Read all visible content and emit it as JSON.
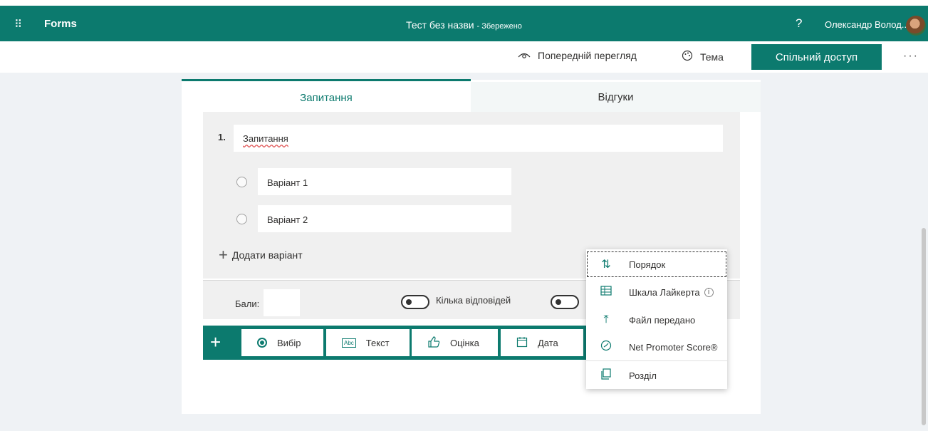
{
  "app": {
    "name": "Forms",
    "doc_title": "Тест без назви",
    "saved_status": "- Збережено",
    "user": "Олександр Волод...",
    "help": "?"
  },
  "toolbar": {
    "preview": "Попередній перегляд",
    "theme": "Тема",
    "share": "Спільний доступ",
    "more": "···"
  },
  "tabs": {
    "questions": "Запитання",
    "responses": "Відгуки"
  },
  "question": {
    "number": "1.",
    "title": "Запитання",
    "options": [
      "Варіант 1",
      "Варіант 2"
    ],
    "add_option": "Додати варіант",
    "score_label": "Бали:",
    "multi_label": "Кілька відповідей"
  },
  "question_types": [
    "Вибір",
    "Текст",
    "Оцінка",
    "Дата"
  ],
  "menu": {
    "items": [
      "Порядок",
      "Шкала Лайкерта",
      "Файл передано",
      "Net Promoter Score®",
      "Розділ"
    ]
  },
  "colors": {
    "accent": "#0c7a6e"
  }
}
